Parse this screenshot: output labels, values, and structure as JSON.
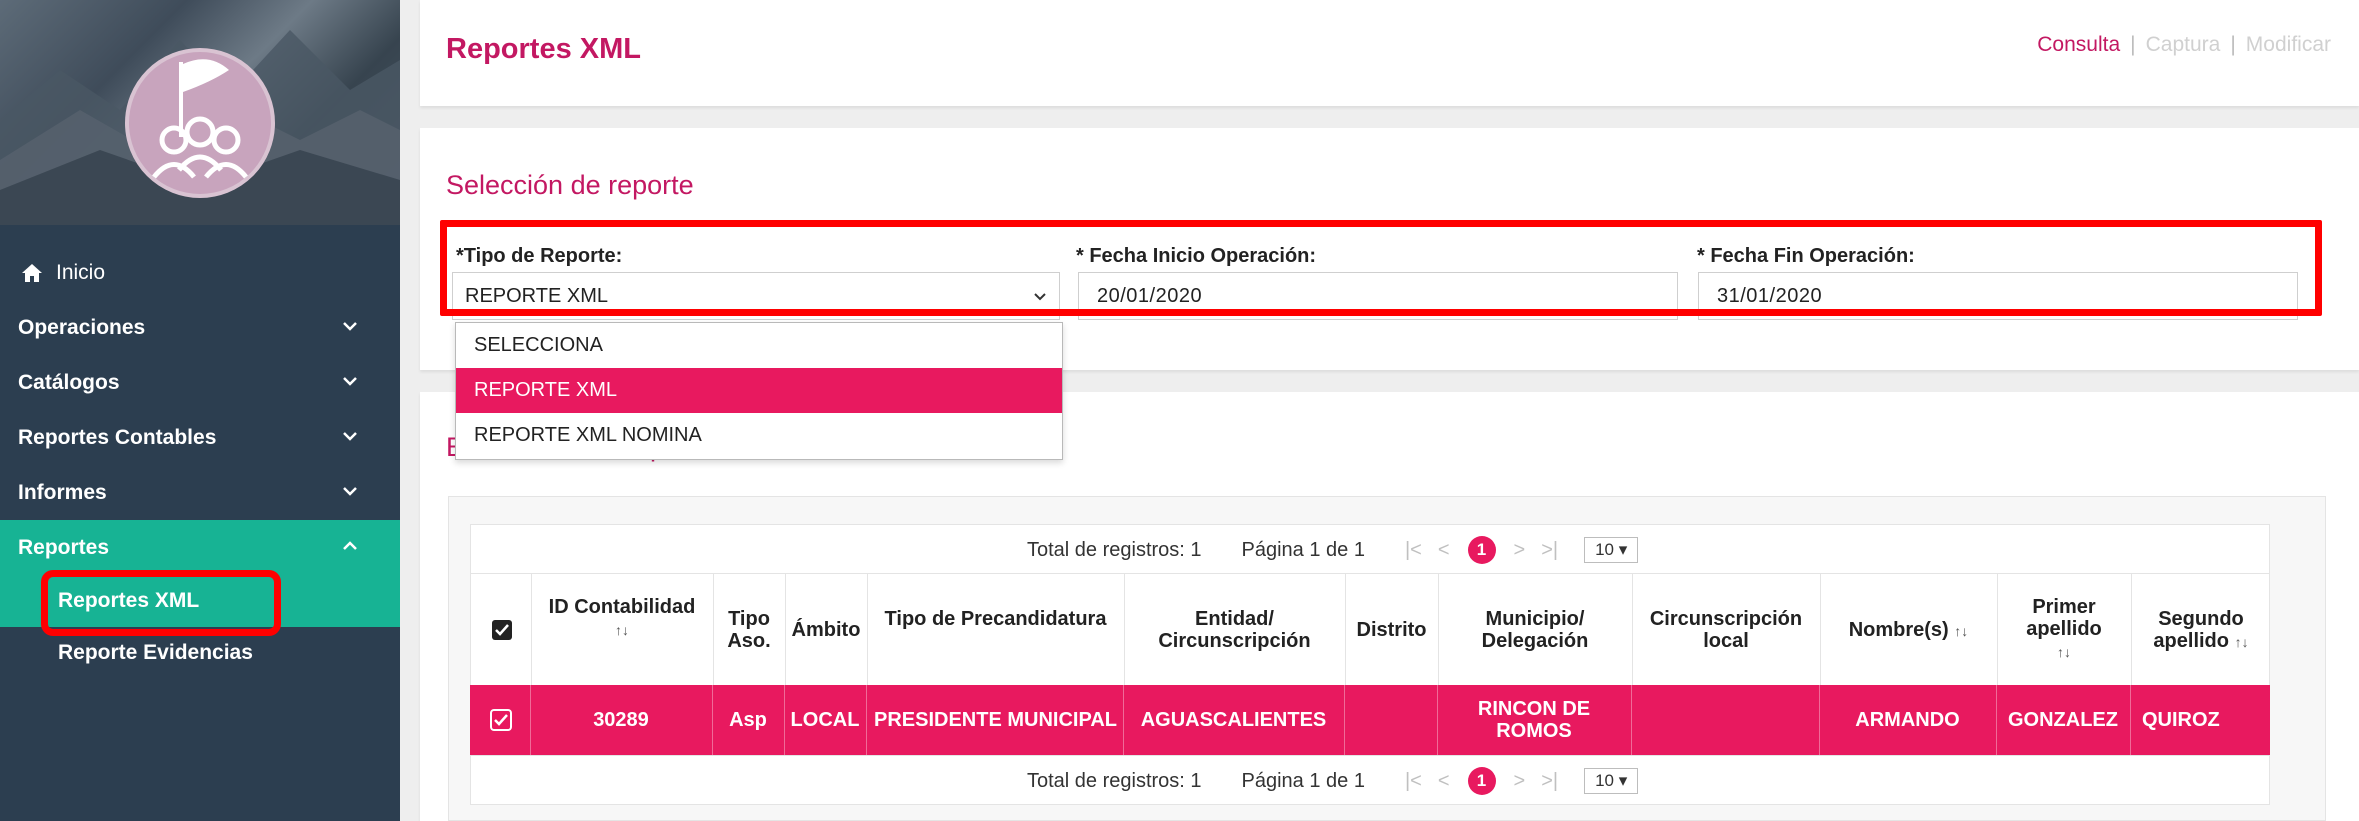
{
  "sidebar": {
    "menu": [
      {
        "label": "Inicio"
      },
      {
        "label": "Operaciones"
      },
      {
        "label": "Catálogos"
      },
      {
        "label": "Reportes Contables"
      },
      {
        "label": "Informes"
      },
      {
        "label": "Reportes"
      }
    ],
    "submenu": [
      {
        "label": "Reportes XML"
      },
      {
        "label": "Reporte Evidencias"
      }
    ]
  },
  "header": {
    "title": "Reportes XML",
    "links": {
      "consulta": "Consulta",
      "captura": "Captura",
      "modificar": "Modificar",
      "separator": "|"
    }
  },
  "selection": {
    "title": "Selección de reporte",
    "tipo_label": "*Tipo de Reporte:",
    "tipo_value": "REPORTE XML",
    "fecha_inicio_label": "* Fecha Inicio Operación:",
    "fecha_inicio_value": "20/01/2020",
    "fecha_fin_label": "* Fecha Fin Operación:",
    "fecha_fin_value": "31/01/2020",
    "options": [
      "SELECCIONA",
      "REPORTE XML",
      "REPORTE XML NOMINA"
    ]
  },
  "results": {
    "title_prefix": "E",
    "title_suffix": "p"
  },
  "pager": {
    "total": "Total de registros: 1",
    "page": "Página 1 de 1",
    "first": "|<",
    "prev": "<",
    "current": "1",
    "next": ">",
    "last": ">|",
    "size": "10 ▾"
  },
  "table": {
    "headers": {
      "id": "ID Contabilidad",
      "tipo": "Tipo Aso.",
      "ambito": "Ámbito",
      "precand": "Tipo de Precandidatura",
      "entidad": "Entidad/ Circunscripción",
      "distrito": "Distrito",
      "municipio": "Municipio/ Delegación",
      "circ_local": "Circunscripción local",
      "nombre": "Nombre(s)",
      "primer": "Primer apellido",
      "segundo": "Segundo apellido"
    },
    "sort_glyph": "↑↓",
    "row": {
      "id": "30289",
      "tipo": "Asp",
      "ambito": "LOCAL",
      "precand": "PRESIDENTE MUNICIPAL",
      "entidad": "AGUASCALIENTES",
      "distrito": "",
      "municipio": "RINCON DE ROMOS",
      "circ_local": "",
      "nombre": "ARMANDO",
      "primer": "GONZALEZ",
      "segundo": "QUIROZ"
    }
  },
  "colors": {
    "accent": "#e8195f",
    "title": "#c31862",
    "sidebar": "#2c3e50",
    "active": "#17b394",
    "highlight": "#ff0000"
  }
}
